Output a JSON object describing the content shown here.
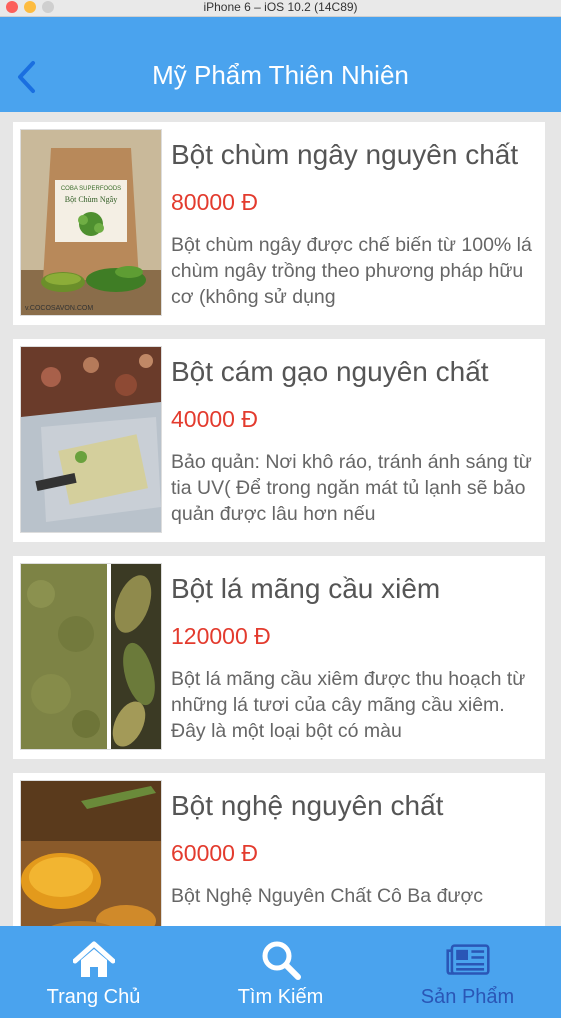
{
  "simulator": {
    "title": "iPhone 6 – iOS 10.2 (14C89)"
  },
  "header": {
    "title": "Mỹ Phẩm Thiên Nhiên",
    "back_icon": "chevron-left-icon"
  },
  "products": [
    {
      "name": "Bột chùm ngây nguyên chất",
      "price": "80000 Đ",
      "description": "Bột chùm ngây được chế biến từ 100% lá chùm ngây trồng theo phương pháp hữu cơ (không sử dụng",
      "image_text": [
        "COBA SUPERFOODS",
        "Bột Chùm Ngây",
        "v.COCOSAVON.COM"
      ]
    },
    {
      "name": "Bột cám gạo nguyên chất",
      "price": "40000 Đ",
      "description": "Bảo quản: Nơi khô ráo, tránh ánh sáng từ tia UV( Để trong ngăn mát tủ lạnh sẽ bảo quản được lâu hơn nếu"
    },
    {
      "name": "Bột lá mãng cầu xiêm",
      "price": "120000 Đ",
      "description": "Bột lá mãng cầu xiêm được thu hoạch từ những lá tươi của cây mãng cầu xiêm. Đây là một loại bột có màu"
    },
    {
      "name": "Bột nghệ nguyên chất",
      "price": "60000 Đ",
      "description": "Bột Nghệ Nguyên Chất Cô Ba được"
    }
  ],
  "tabbar": {
    "items": [
      {
        "label": "Trang Chủ",
        "icon": "home-icon",
        "active": false
      },
      {
        "label": "Tìm Kiếm",
        "icon": "search-icon",
        "active": false
      },
      {
        "label": "Sản Phẩm",
        "icon": "newspaper-icon",
        "active": true
      }
    ]
  },
  "colors": {
    "primary": "#4aa3ee",
    "price": "#e33b2e",
    "active_tab": "#2a56b6",
    "background": "#e6e6e6"
  }
}
